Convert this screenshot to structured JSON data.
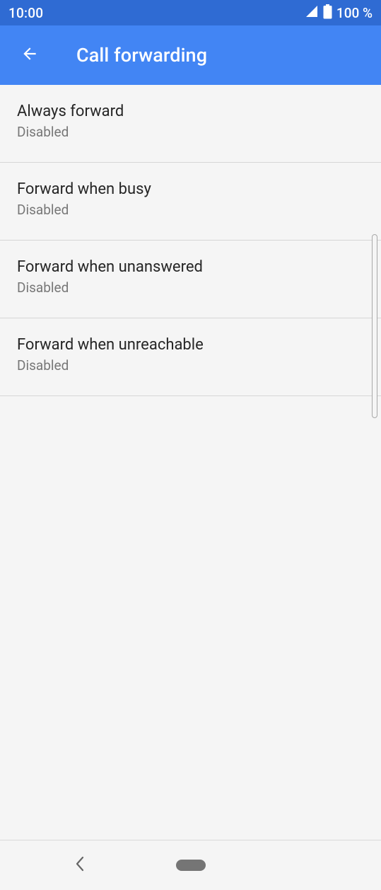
{
  "status_bar": {
    "time": "10:00",
    "battery_percent": "100 %",
    "icons": [
      "signal-icon",
      "battery-icon"
    ]
  },
  "app_bar": {
    "title": "Call forwarding",
    "back_icon": "arrow-back-icon"
  },
  "colors": {
    "status_bar": "#2f6bd3",
    "app_bar": "#4285f4",
    "background": "#f5f5f5"
  },
  "settings": [
    {
      "title": "Always forward",
      "summary": "Disabled"
    },
    {
      "title": "Forward when busy",
      "summary": "Disabled"
    },
    {
      "title": "Forward when unanswered",
      "summary": "Disabled"
    },
    {
      "title": "Forward when unreachable",
      "summary": "Disabled"
    }
  ],
  "nav_bar": {
    "icons": [
      "nav-back-icon",
      "home-pill-icon"
    ]
  }
}
